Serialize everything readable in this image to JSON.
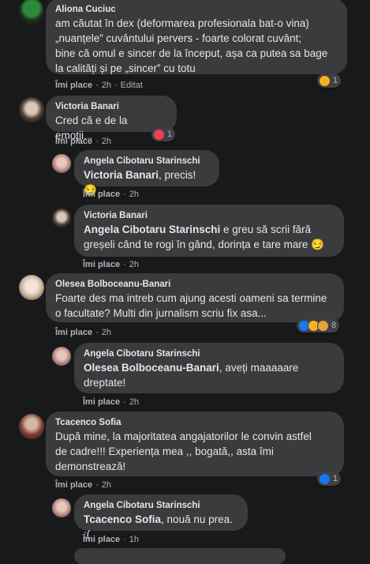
{
  "comments": [
    {
      "author": "Aliona Cuciuc",
      "lines": [
        "am căutat în dex (deformarea profesionala bat-o vina)",
        "„nuanțele” cuvântului pervers - foarte colorat cuvânt;",
        "bine că omul e sincer de la început, așa ca putea sa bage",
        "la calități și pe „sincer” cu totu"
      ],
      "like": "Îmi place",
      "time": "2h",
      "edited": "Editat",
      "reaction_count": "1",
      "reaction_icons": [
        "haha-icon"
      ]
    },
    {
      "author": "Victoria Banari",
      "lines": [
        "Cred că e de la emoții..."
      ],
      "like": "Îmi place",
      "time": "2h",
      "reaction_count": "1",
      "reaction_icons": [
        "love-icon"
      ]
    },
    {
      "author": "Angela Cibotaru Starinschi",
      "tag": "Victoria Banari",
      "lines": [
        ", precis! 😏"
      ],
      "like": "Îmi place",
      "time": "2h"
    },
    {
      "author": "Victoria Banari",
      "tag": "Angela Cibotaru Starinschi",
      "lines": [
        " e greu să scrii fără",
        "greșeli când te rogi în gând, dorința e tare mare 😏"
      ],
      "like": "Îmi place",
      "time": "2h"
    },
    {
      "author": "Olesea Bolboceanu-Banari",
      "lines": [
        "Foarte des ma intreb cum ajung acesti oameni sa termine",
        "o facultate? Multi din jurnalism scriu fix asa..."
      ],
      "like": "Îmi place",
      "time": "2h",
      "reaction_count": "8",
      "reaction_icons": [
        "like-icon",
        "haha-icon",
        "sad-icon"
      ]
    },
    {
      "author": "Angela Cibotaru Starinschi",
      "tag": "Olesea Bolboceanu-Banari",
      "lines": [
        ", aveți maaaaare",
        "dreptate!"
      ],
      "like": "Îmi place",
      "time": "2h"
    },
    {
      "author": "Tcacenco Sofia",
      "lines": [
        "După mine, la majoritatea angajatorilor le convin astfel",
        "de cadre!!! Experiența mea ,, bogată,, asta îmi",
        "demonstrează!"
      ],
      "like": "Îmi place",
      "time": "2h",
      "reaction_count": "1",
      "reaction_icons": [
        "like-icon"
      ]
    },
    {
      "author": "Angela Cibotaru Starinschi",
      "tag": "Tcacenco Sofia",
      "lines": [
        ", nouă nu prea. :("
      ],
      "like": "Îmi place",
      "time": "1h"
    }
  ],
  "colors": {
    "like": "#1877f2",
    "love": "#f33e58",
    "haha": "#f7b125"
  }
}
